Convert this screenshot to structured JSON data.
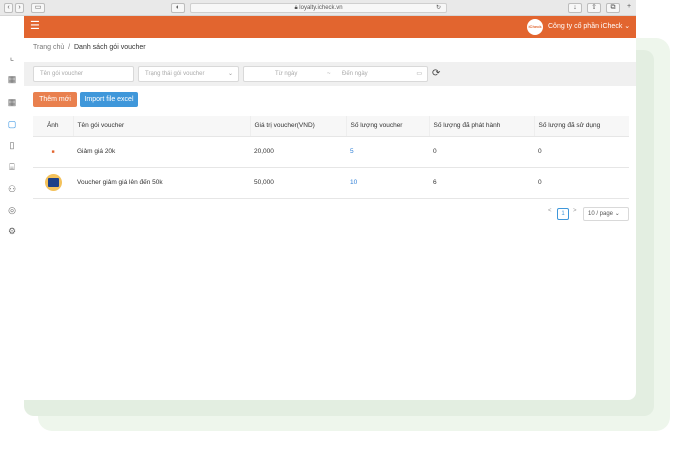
{
  "browser": {
    "url": "loyalty.icheck.vn"
  },
  "header": {
    "logo_text": "iCheck",
    "company": "Công ty cổ phần iCheck"
  },
  "breadcrumb": {
    "home": "Trang chủ",
    "separator": "/",
    "current": "Danh sách gói voucher"
  },
  "filters": {
    "name_placeholder": "Tên gói voucher",
    "status_placeholder": "Trạng thái gói voucher",
    "from_placeholder": "Từ ngày",
    "range_sep": "~",
    "to_placeholder": "Đến ngày"
  },
  "actions": {
    "add_label": "Thêm mới",
    "import_label": "Import file excel"
  },
  "table": {
    "columns": [
      "Ảnh",
      "Tên gói voucher",
      "Giá trị voucher(VND)",
      "Số lượng voucher",
      "Số lượng đã phát hành",
      "Số lượng đã sử dụng"
    ],
    "rows": [
      {
        "name": "Giảm giá 20k",
        "value": "20,000",
        "qty": "5",
        "issued": "0",
        "used": "0"
      },
      {
        "name": "Voucher giảm giá lên đến 50k",
        "value": "50,000",
        "qty": "10",
        "issued": "6",
        "used": "0"
      }
    ]
  },
  "pagination": {
    "prev": "<",
    "current_page": "1",
    "next": ">",
    "page_size": "10 / page"
  },
  "colors": {
    "header": "#e2652f",
    "add_button": "#e9804e",
    "import_button": "#3f97da",
    "link": "#2f7fd6"
  },
  "icons": {
    "sidebar": [
      "chart-icon",
      "grid-icon",
      "grid-icon",
      "voucher-icon",
      "document-icon",
      "gift-icon",
      "users-icon",
      "coin-icon",
      "settings-icon"
    ]
  }
}
